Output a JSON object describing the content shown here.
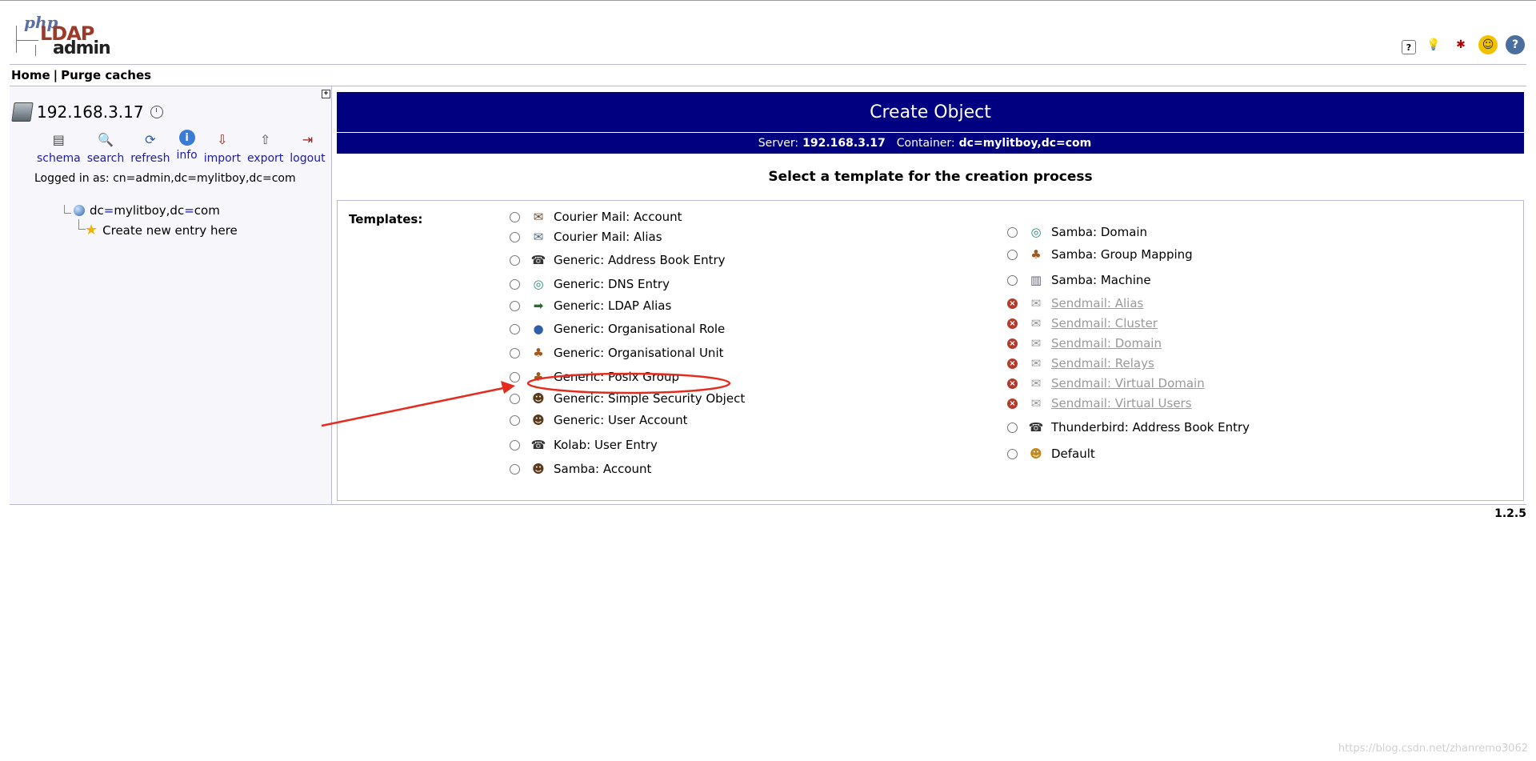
{
  "header": {
    "logo": {
      "php": "php",
      "ldap": "LDAP",
      "admin": "admin"
    },
    "top_icons": [
      "help-icon",
      "lightbulb-icon",
      "bug-icon",
      "smiley-icon",
      "question-icon"
    ]
  },
  "menu": {
    "home": "Home",
    "separator": "|",
    "purge": "Purge caches"
  },
  "sidebar": {
    "expand_glyph": "+",
    "server": "192.168.3.17",
    "tools": [
      {
        "label": "schema",
        "icon": "schema-icon",
        "glyph": "▤"
      },
      {
        "label": "search",
        "icon": "search-icon",
        "glyph": "🔍"
      },
      {
        "label": "refresh",
        "icon": "refresh-icon",
        "glyph": "⟳"
      },
      {
        "label": "info",
        "icon": "info-icon",
        "glyph": "i"
      },
      {
        "label": "import",
        "icon": "import-icon",
        "glyph": "⇩"
      },
      {
        "label": "export",
        "icon": "export-icon",
        "glyph": "⇧"
      },
      {
        "label": "logout",
        "icon": "logout-icon",
        "glyph": "⇥"
      }
    ],
    "logged_in": "Logged in as: cn=admin,dc=mylitboy,dc=com",
    "tree_root": {
      "part1": "dc",
      "eq": "=",
      "part2": "mylitboy",
      "comma": " , ",
      "part3": "dc",
      "eq2": "=",
      "part4": "com"
    },
    "tree_child": "Create new entry here"
  },
  "main": {
    "title": "Create Object",
    "server_label": "Server:",
    "server_value": "192.168.3.17",
    "container_label": "Container:",
    "container_value": "dc=mylitboy,dc=com",
    "select_heading": "Select a template for the creation process",
    "templates_label": "Templates:",
    "left_templates": [
      "Courier Mail: Account",
      "Courier Mail: Alias",
      "Generic: Address Book Entry",
      "Generic: DNS Entry",
      "Generic: LDAP Alias",
      "Generic: Organisational Role",
      "Generic: Organisational Unit",
      "Generic: Posix Group",
      "Generic: Simple Security Object",
      "Generic: User Account",
      "Kolab: User Entry",
      "Samba: Account"
    ],
    "right_templates": [
      "Samba: Domain",
      "Samba: Group Mapping",
      "Samba: Machine",
      "Sendmail: Alias",
      "Sendmail: Cluster",
      "Sendmail: Domain",
      "Sendmail: Relays",
      "Sendmail: Virtual Domain",
      "Sendmail: Virtual Users",
      "Thunderbird: Address Book Entry",
      "Default"
    ],
    "disabled_marker": "×"
  },
  "footer": {
    "version": "1.2.5",
    "watermark": "https://blog.csdn.net/zhanremo3062"
  },
  "colors": {
    "title_bg": "#000080",
    "annotation": "#e52a1e"
  }
}
